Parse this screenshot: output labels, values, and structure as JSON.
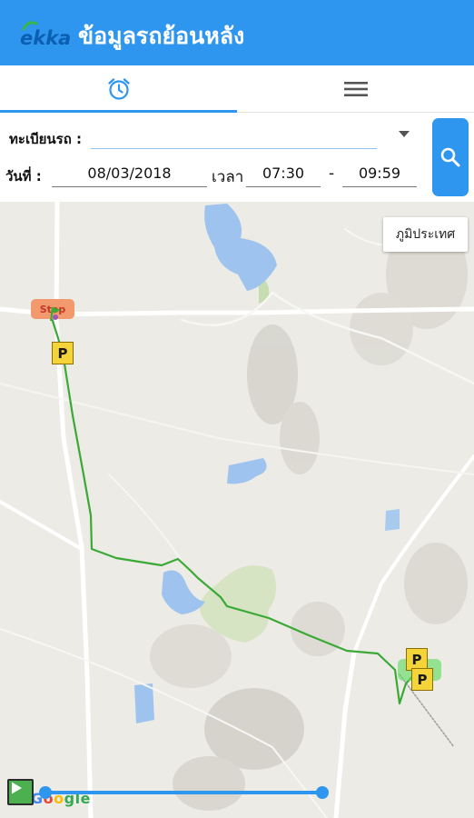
{
  "header": {
    "logo_text": "ekka",
    "title": "ข้อมูลรถย้อนหลัง",
    "background_color": "#2f96f0"
  },
  "tabs": [
    {
      "name": "history",
      "icon": "alarm-clock-icon",
      "active": true
    },
    {
      "name": "menu",
      "icon": "hamburger-menu-icon",
      "active": false
    }
  ],
  "form": {
    "plate_label": "ทะเบียนรถ :",
    "plate_value": "",
    "date_label": "วันที่ :",
    "date_value": "08/03/2018",
    "time_label": "เวลา",
    "time_start": "07:30",
    "time_separator": "-",
    "time_end": "09:59",
    "search_icon": "search-icon"
  },
  "map": {
    "terrain_button": "ภูมิประเทศ",
    "stop_label": "Stop",
    "parking_label": "P",
    "route_color": "#3aa935",
    "attribution": {
      "part1": "G",
      "part2": "o",
      "part3": "o",
      "part4": "gle"
    }
  },
  "playback": {
    "play_icon": "play-icon",
    "slider_start": 0,
    "slider_end": 1
  }
}
